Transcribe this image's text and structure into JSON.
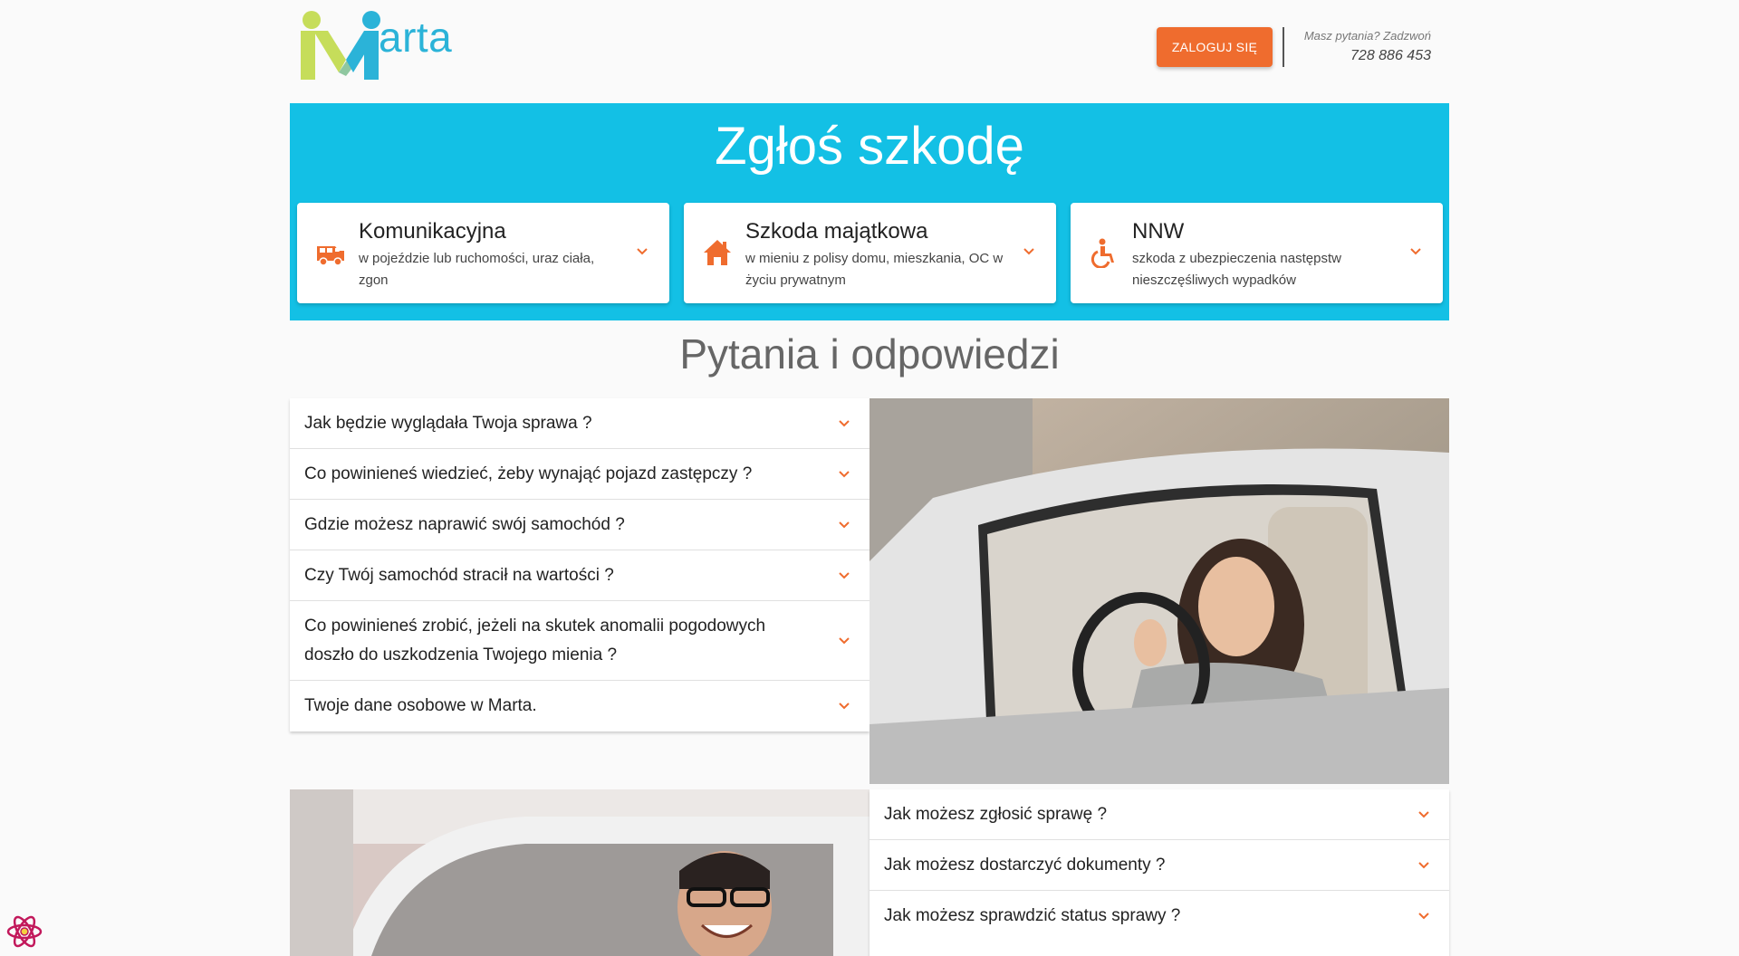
{
  "header": {
    "logo_text": "arta",
    "login_label": "ZALOGUJ SIĘ",
    "contact_question": "Masz pytania? Zadzwoń",
    "contact_phone": "728 886 453"
  },
  "banner": {
    "title": "Zgłoś szkodę",
    "cards": [
      {
        "title": "Komunikacyjna",
        "desc": "w pojeździe lub ruchomości, uraz ciała, zgon",
        "icon": "van-icon"
      },
      {
        "title": "Szkoda majątkowa",
        "desc": "w mieniu z polisy domu, mieszkania, OC w życiu prywatnym",
        "icon": "house-icon"
      },
      {
        "title": "NNW",
        "desc": "szkoda z ubezpieczenia następstw nieszczęśliwych wypadków",
        "icon": "accessible-icon"
      }
    ]
  },
  "faq": {
    "title": "Pytania i odpowiedzi",
    "left_questions": [
      "Jak będzie wyglądała Twoja sprawa ?",
      "Co powinieneś wiedzieć, żeby wynająć pojazd zastępczy ?",
      "Gdzie możesz naprawić swój samochód ?",
      "Czy Twój samochód stracił na wartości ?",
      "Co powinieneś zrobić, jeżeli na skutek anomalii pogodowych doszło do uszkodzenia Twojego mienia ?",
      "Twoje dane osobowe w Marta."
    ],
    "right_questions": [
      "Jak możesz zgłosić sprawę ?",
      "Jak możesz dostarczyć dokumenty ?",
      "Jak możesz sprawdzić status sprawy ?"
    ]
  },
  "colors": {
    "accent": "#ef6c2e",
    "banner": "#13c0e5",
    "logo_blue": "#2bb3d8",
    "logo_green": "#c6dd5a"
  }
}
